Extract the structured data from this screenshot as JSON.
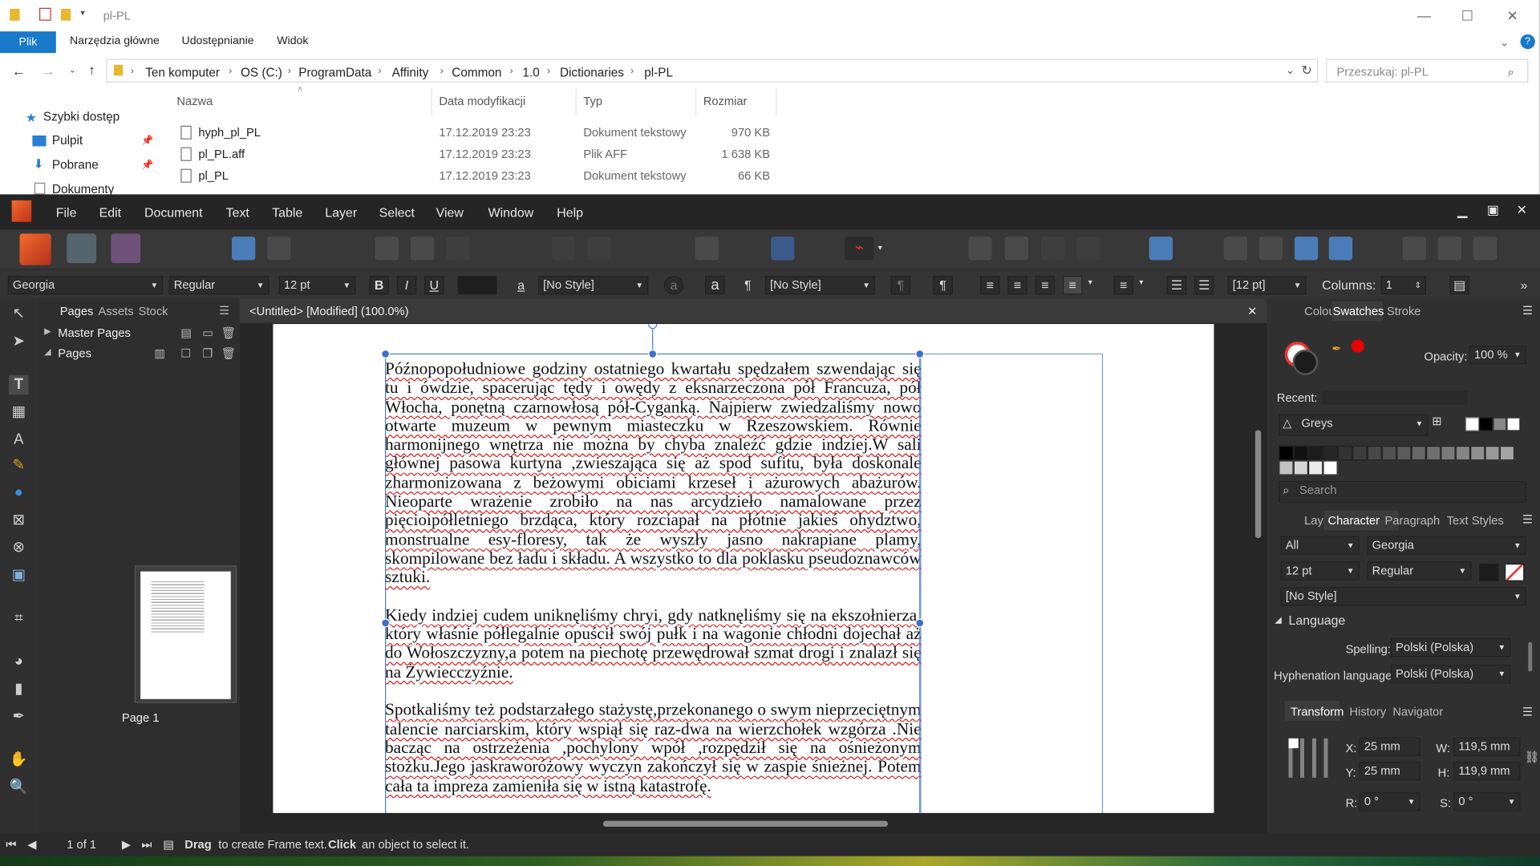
{
  "explorer": {
    "title": "pl-PL",
    "ribbon_tabs": [
      "Plik",
      "Narzędzia główne",
      "Udostępnianie",
      "Widok"
    ],
    "breadcrumb": [
      "Ten komputer",
      "OS (C:)",
      "ProgramData",
      "Affinity",
      "Common",
      "1.0",
      "Dictionaries",
      "pl-PL"
    ],
    "search_placeholder": "Przeszukaj: pl-PL",
    "nav": [
      "Szybki dostęp",
      "Pulpit",
      "Pobrane",
      "Dokumenty"
    ],
    "columns": [
      "Nazwa",
      "Data modyfikacji",
      "Typ",
      "Rozmiar"
    ],
    "files": [
      {
        "name": "hyph_pl_PL",
        "date": "17.12.2019 23:23",
        "type": "Dokument tekstowy",
        "size": "970 KB"
      },
      {
        "name": "pl_PL.aff",
        "date": "17.12.2019 23:23",
        "type": "Plik AFF",
        "size": "1 638 KB"
      },
      {
        "name": "pl_PL",
        "date": "17.12.2019 23:23",
        "type": "Dokument tekstowy",
        "size": "66 KB"
      }
    ]
  },
  "menu": [
    "File",
    "Edit",
    "Document",
    "Text",
    "Table",
    "Layer",
    "Select",
    "View",
    "Window",
    "Help"
  ],
  "context": {
    "font": "Georgia",
    "style": "Regular",
    "size": "12 pt",
    "char_style": "[No Style]",
    "para_style": "[No Style]",
    "leading": "[12 pt]",
    "columns_label": "Columns:",
    "columns": "1"
  },
  "pages_panel": {
    "tabs": [
      "Pages",
      "Assets",
      "Stock"
    ],
    "master": "Master Pages",
    "pages": "Pages",
    "page1": "Page 1"
  },
  "document": {
    "tab": "<Untitled> [Modified] (100.0%)",
    "paragraphs": [
      "Późnopopołudniowe godziny ostatniego kwartału spędzałem szwendając się tu i ówdzie, spacerując tędy i owędy z eksnarzeczona pół Francuza, pół Włocha, ponętną czarnowłosą pół-Cyganką. Najpierw zwiedzaliśmy nowo otwarte muzeum w pewnym miasteczku w Rzeszowskiem. Równie harmonijnego wnętrza nie można by chyba znaleźć gdzie indziej.W sali głównej pasowa kurtyna ,zwieszająca się aż spod sufitu, była doskonale zharmonizowana z beżowymi obiciami krzeseł i ażurowych abażurów. Nieoparte wrażenie zrobiło na nas arcydzieło namalowane przez pięcioipółletniego brzdąca, który rozciapał na płótnie jakieś ohydztwo, monstrualne esy-floresy, tak że wyszły jasno nakrapiane plamy, skompilowane bez ładu i składu. A wszystko to dla poklasku pseudoznawców sztuki.",
      "Kiedy indziej cudem uniknęliśmy chryi, gdy natknęliśmy się na ekszołnierza, który właśnie półlegalnie opuścił swój pułk i na wagonie chłodni dojechał aż do Wołoszczyzny,a potem na piechotę przewędrował szmat drogi i znalazł się na Żywiecczyźnie.",
      "Spotkaliśmy też podstarzałego stażystę,przekonanego o swym nieprzeciętnym talencie narciarskim, który wspiął się raz-dwa na wierzchołek wzgórza .Nie bacząc na ostrzeżenia ,pochylony wpół ,rozpędził się na ośnieżonym stożku.Jego jaskraworóżowy wyczyn zakończył się w zaspie śnieżnej. Potem cała ta impreza zamieniła się w istną katastrofę."
    ]
  },
  "right": {
    "top_tabs": [
      "Colour",
      "Swatches",
      "Stroke"
    ],
    "opacity_label": "Opacity:",
    "opacity": "100 %",
    "recent_label": "Recent:",
    "palette": "Greys",
    "search": "Search",
    "char_tabs": [
      "Layers",
      "Character",
      "Paragraph",
      "Text Styles"
    ],
    "char": {
      "scope": "All",
      "font": "Georgia",
      "size": "12 pt",
      "style": "Regular",
      "nostyle": "[No Style]"
    },
    "language": "Language",
    "spelling_label": "Spelling:",
    "spelling": "Polski (Polska)",
    "hyph_label": "Hyphenation language:",
    "hyph": "Polski (Polska)",
    "transform_tabs": [
      "Transform",
      "History",
      "Navigator"
    ],
    "transform": {
      "x": "25 mm",
      "y": "25 mm",
      "w": "119,5 mm",
      "h": "119,9 mm",
      "r": "0 °",
      "s": "0 °"
    },
    "labels": {
      "x": "X:",
      "y": "Y:",
      "w": "W:",
      "h": "H:",
      "r": "R:",
      "s": "S:"
    }
  },
  "status": {
    "page": "1 of 1",
    "drag": "Drag",
    "drag_text": " to create Frame text. ",
    "click": "Click",
    "click_text": " an object to select it."
  },
  "colors": {
    "accent": "#1979ca",
    "selection": "#3b6fd0",
    "spell": "#e02020"
  }
}
